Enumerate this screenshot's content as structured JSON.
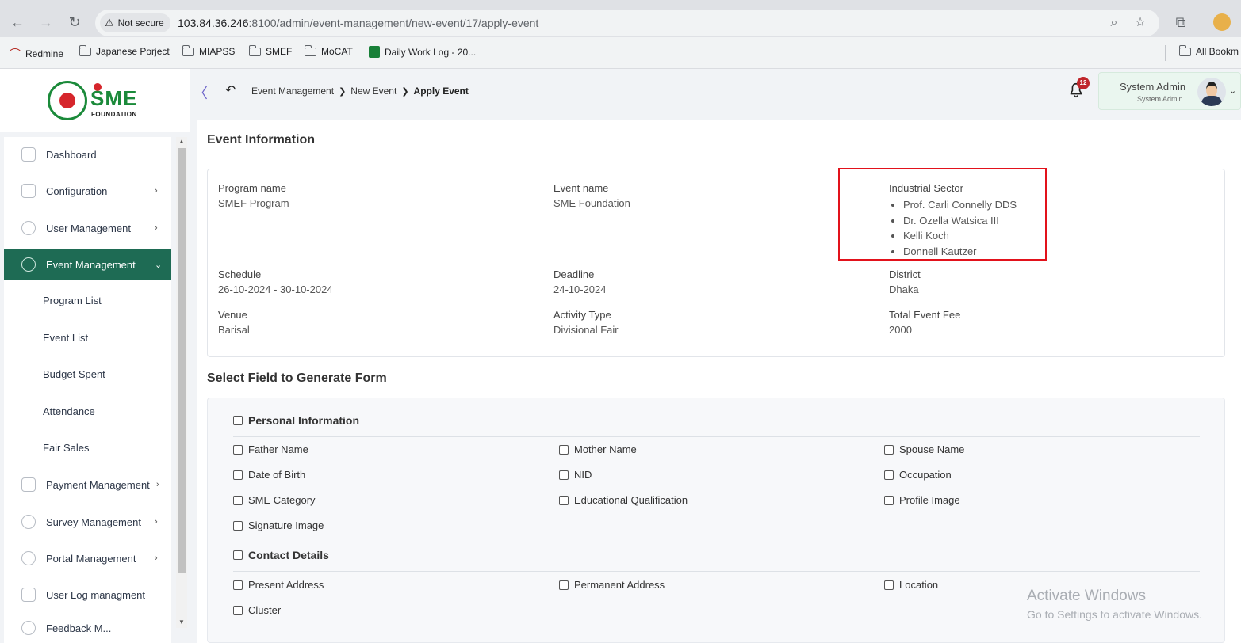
{
  "browser": {
    "security_label": "Not secure",
    "url_host": "103.84.36.246",
    "url_path": ":8100/admin/event-management/new-event/17/apply-event",
    "bookmarks": [
      "Redmine",
      "Japanese Porject",
      "MIAPSS",
      "SMEF",
      "MoCAT",
      "Daily Work Log - 20...",
      "All Bookm"
    ]
  },
  "logo": {
    "brand": "SME",
    "subtitle": "FOUNDATION"
  },
  "topbar": {
    "breadcrumb": [
      "Event Management",
      "New Event",
      "Apply Event"
    ],
    "notification_count": "12",
    "user_name": "System Admin",
    "user_role": "System Admin"
  },
  "sidebar": {
    "items": [
      {
        "label": "Dashboard",
        "chevron": ""
      },
      {
        "label": "Configuration",
        "chevron": "›"
      },
      {
        "label": "User Management",
        "chevron": "›"
      },
      {
        "label": "Event Management",
        "chevron": "⌄"
      },
      {
        "label": "Payment Management",
        "chevron": "›"
      },
      {
        "label": "Survey Management",
        "chevron": "›"
      },
      {
        "label": "Portal Management",
        "chevron": "›"
      },
      {
        "label": "User Log managment",
        "chevron": ""
      },
      {
        "label": "Feedback M...",
        "chevron": ""
      }
    ],
    "sub_items": [
      "Program List",
      "Event List",
      "Budget Spent",
      "Attendance",
      "Fair Sales"
    ]
  },
  "event_info": {
    "title": "Event Information",
    "program_name_label": "Program name",
    "program_name": "SMEF Program",
    "event_name_label": "Event name",
    "event_name": "SME Foundation",
    "industrial_sector_label": "Industrial Sector",
    "industrial_sectors": [
      "Prof. Carli Connelly DDS",
      "Dr. Ozella Watsica III",
      "Kelli Koch",
      "Donnell Kautzer"
    ],
    "schedule_label": "Schedule",
    "schedule": "26-10-2024 - 30-10-2024",
    "deadline_label": "Deadline",
    "deadline": "24-10-2024",
    "district_label": "District",
    "district": "Dhaka",
    "venue_label": "Venue",
    "venue": "Barisal",
    "activity_type_label": "Activity Type",
    "activity_type": "Divisional Fair",
    "total_fee_label": "Total Event Fee",
    "total_fee": "2000"
  },
  "form_fields": {
    "title": "Select Field to Generate Form",
    "personal_title": "Personal Information",
    "personal": [
      "Father Name",
      "Mother Name",
      "Spouse Name",
      "Date of Birth",
      "NID",
      "Occupation",
      "SME Category",
      "Educational Qualification",
      "Profile Image",
      "Signature Image"
    ],
    "contact_title": "Contact Details",
    "contact": [
      "Present Address",
      "Permanent Address",
      "Location",
      "Cluster"
    ]
  },
  "watermark": {
    "line1": "Activate Windows",
    "line2": "Go to Settings to activate Windows."
  },
  "colors": {
    "accent": "#1e6b54",
    "highlight": "#e2121b",
    "badge": "#c0252b"
  }
}
